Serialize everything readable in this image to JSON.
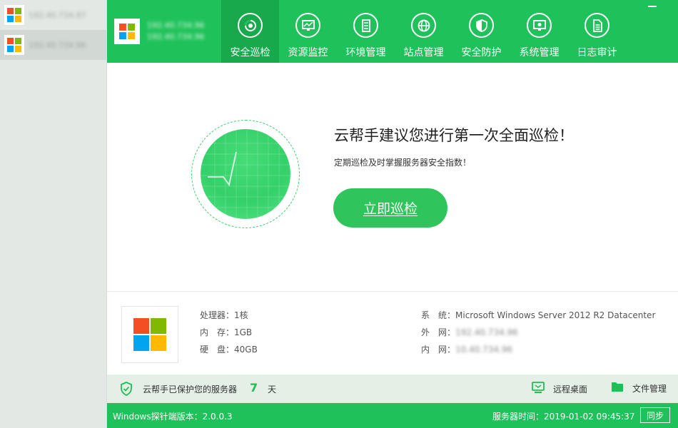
{
  "sidebar": {
    "servers": [
      {
        "ip": "192.40.734.97",
        "active": false
      },
      {
        "ip": "192.40.734.96",
        "active": true
      }
    ]
  },
  "header": {
    "brand_line1": "192.40.734.96",
    "brand_line2": "192.40.734.96",
    "nav": [
      {
        "label": "安全巡检",
        "icon": "eye-scan-icon",
        "active": true
      },
      {
        "label": "资源监控",
        "icon": "monitor-chart-icon",
        "active": false
      },
      {
        "label": "环境管理",
        "icon": "server-stack-icon",
        "active": false
      },
      {
        "label": "站点管理",
        "icon": "globe-icon",
        "active": false
      },
      {
        "label": "安全防护",
        "icon": "shield-icon",
        "active": false
      },
      {
        "label": "系统管理",
        "icon": "settings-monitor-icon",
        "active": false
      },
      {
        "label": "日志审计",
        "icon": "document-icon",
        "active": false
      }
    ]
  },
  "hero": {
    "title": "云帮手建议您进行第一次全面巡检！",
    "subtitle": "定期巡检及时掌握服务器安全指数！",
    "button_label": "立即巡检"
  },
  "info": {
    "cpu_label": "处理器：",
    "cpu_value": "1核",
    "mem_label": "内　存：",
    "mem_value": "1GB",
    "disk_label": "硬　盘：",
    "disk_value": "40GB",
    "sys_label": "系　统：",
    "sys_value": "Microsoft Windows Server 2012 R2 Datacenter",
    "wan_label": "外　网：",
    "wan_value": "192.40.734.96",
    "lan_label": "内　网：",
    "lan_value": "10.40.734.96"
  },
  "status": {
    "protect_text": "云帮手已保护您的服务器",
    "days": "7",
    "days_unit": "天",
    "remote_label": "远程桌面",
    "files_label": "文件管理"
  },
  "footer": {
    "version": "Windows探针端版本：2.0.0.3",
    "server_time": "服务器时间：2019-01-02 09:45:37",
    "sync_label": "同步"
  },
  "colors": {
    "primary": "#1fc25a",
    "primary_dark": "#18a94c",
    "win_red": "#f25022",
    "win_green": "#7fba00",
    "win_blue": "#00a4ef",
    "win_yellow": "#ffb900"
  }
}
